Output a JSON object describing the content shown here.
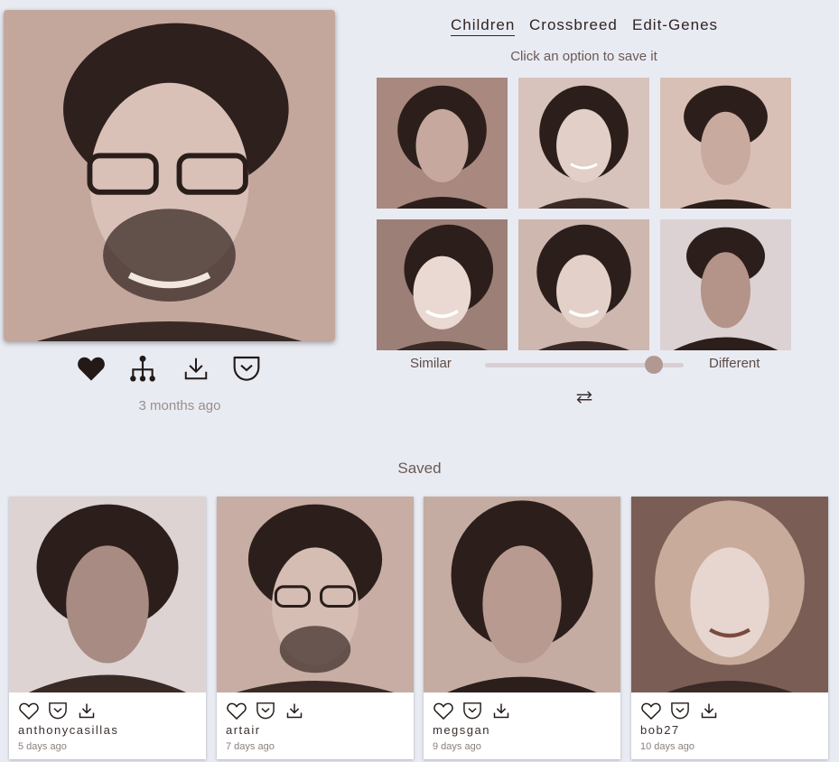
{
  "tabs": [
    {
      "label": "Children",
      "active": true
    },
    {
      "label": "Crossbreed",
      "active": false
    },
    {
      "label": "Edit-Genes",
      "active": false
    }
  ],
  "instruction": "Click an option to save it",
  "main": {
    "timestamp": "3 months ago",
    "actions": [
      "heart-filled-icon",
      "family-tree-icon",
      "download-icon",
      "pocket-icon"
    ]
  },
  "options_grid": {
    "rows": 2,
    "cols": 3,
    "items": [
      "woman-portrait",
      "woman-portrait",
      "man-portrait",
      "woman-portrait",
      "woman-portrait",
      "man-portrait"
    ]
  },
  "slider": {
    "left_label": "Similar",
    "right_label": "Different",
    "value": 0.85
  },
  "regenerate_icon": "swap-arrows-icon",
  "saved": {
    "heading": "Saved",
    "cards": [
      {
        "username": "anthonycasillas",
        "time": "5 days ago"
      },
      {
        "username": "artair",
        "time": "7 days ago"
      },
      {
        "username": "megsgan",
        "time": "9 days ago"
      },
      {
        "username": "bob27",
        "time": "10 days ago"
      }
    ]
  },
  "colors": {
    "background": "#e9ebf3",
    "sepia_dark": "#3b2a26",
    "sepia_light": "#c9aea5",
    "slider_thumb": "#b29893"
  }
}
